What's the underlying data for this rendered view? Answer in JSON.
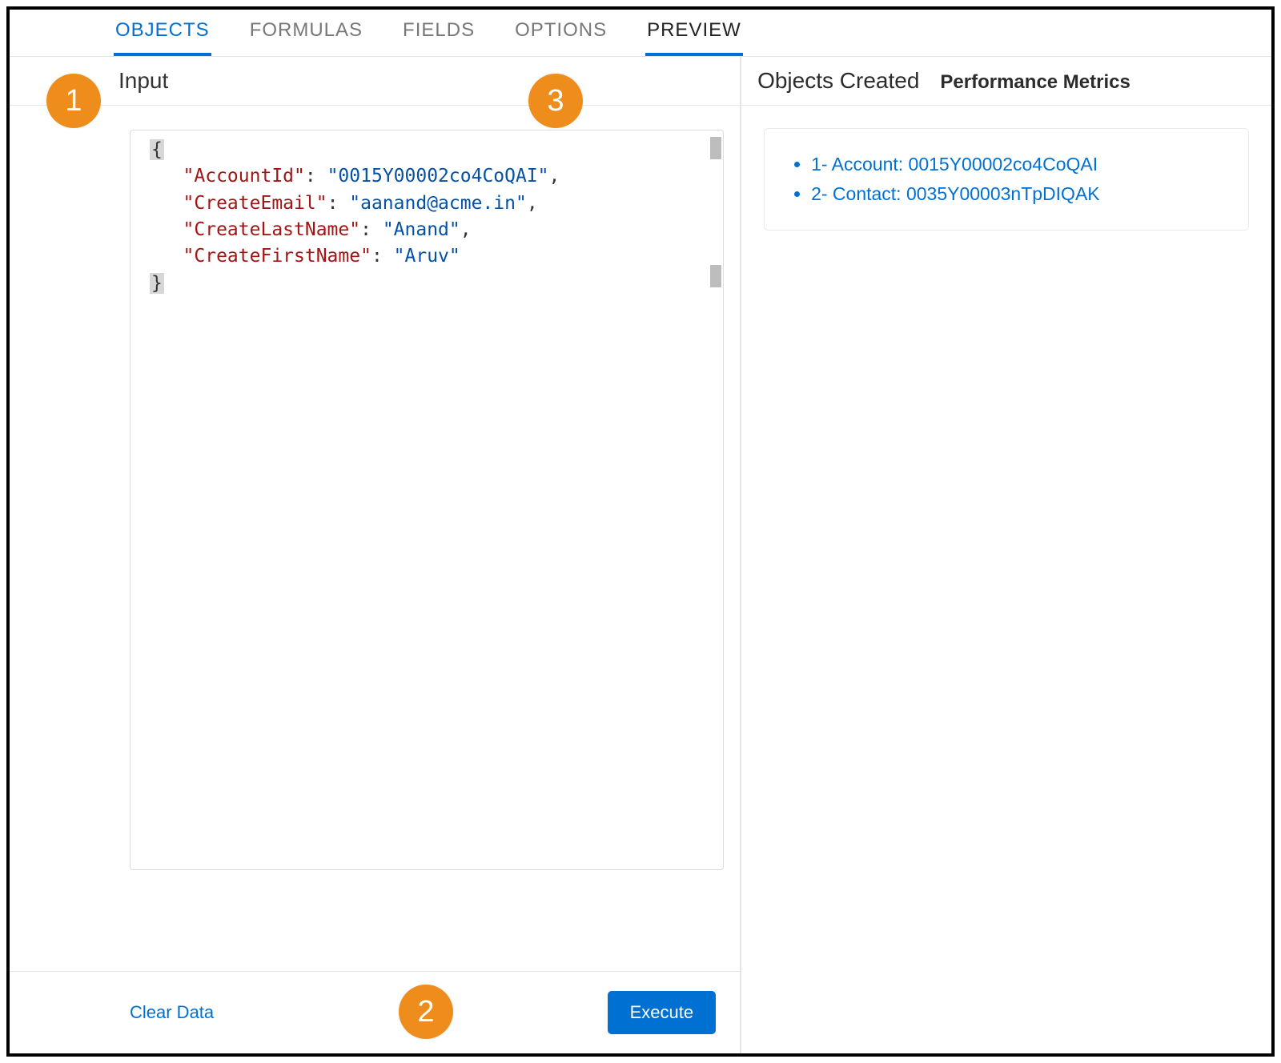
{
  "tabs": {
    "objects": "OBJECTS",
    "formulas": "FORMULAS",
    "fields": "FIELDS",
    "options": "OPTIONS",
    "preview": "PREVIEW"
  },
  "left": {
    "title": "Input",
    "json_keys": {
      "account_id": "\"AccountId\"",
      "create_email": "\"CreateEmail\"",
      "create_last_name": "\"CreateLastName\"",
      "create_first_name": "\"CreateFirstName\""
    },
    "json_values": {
      "account_id": "\"0015Y00002co4CoQAI\"",
      "create_email": "\"aanand@acme.in\"",
      "create_last_name": "\"Anand\"",
      "create_first_name": "\"Aruv\""
    },
    "footer": {
      "clear": "Clear Data",
      "execute": "Execute"
    }
  },
  "right": {
    "title": "Objects Created",
    "secondary": "Performance Metrics",
    "items": [
      "1- Account: 0015Y00002co4CoQAI",
      "2- Contact: 0035Y00003nTpDIQAK"
    ]
  },
  "callouts": {
    "one": "1",
    "two": "2",
    "three": "3"
  }
}
